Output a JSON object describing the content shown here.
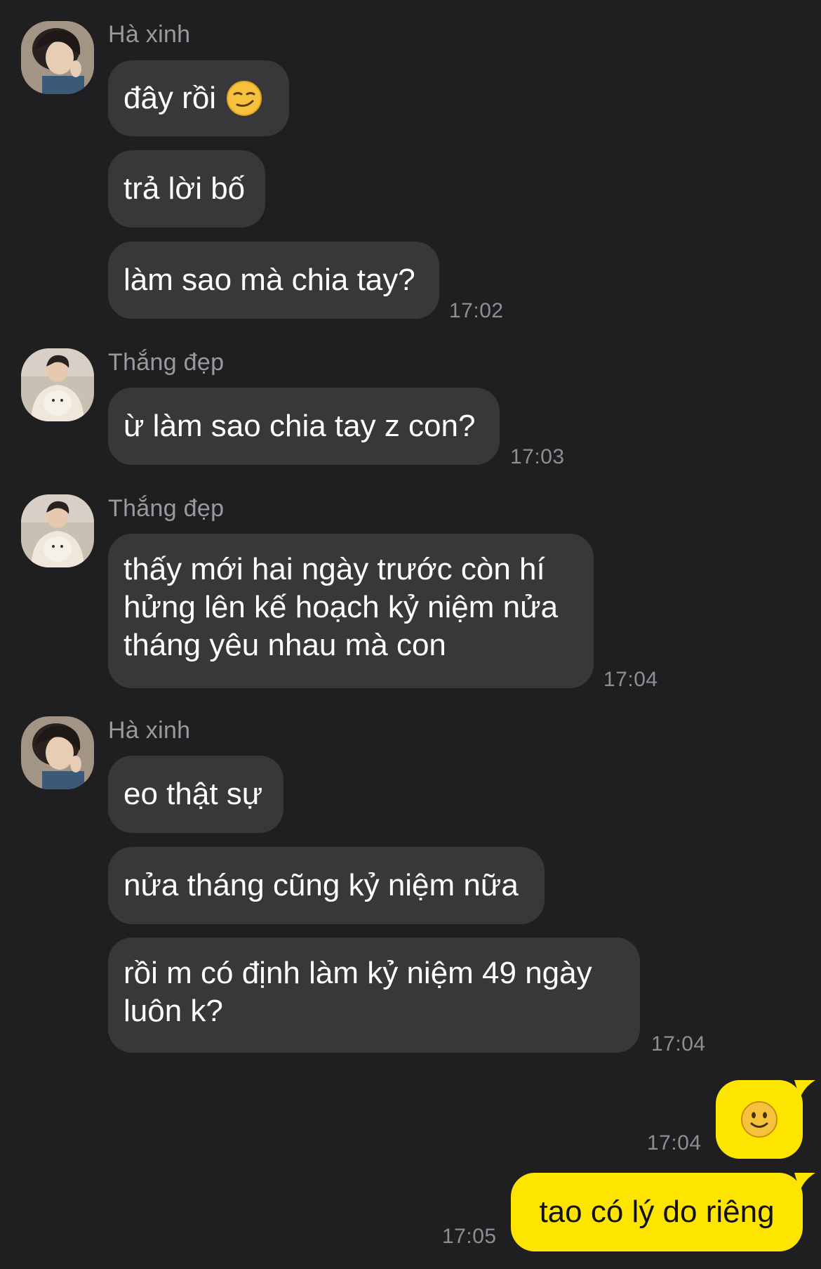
{
  "contacts": {
    "ha": {
      "name": "Hà xinh"
    },
    "thang": {
      "name": "Thắng đẹp"
    }
  },
  "colors": {
    "background": "#1f1f21",
    "incoming_bubble": "#38383a",
    "outgoing_bubble": "#fee500",
    "sender_name": "#9a9a9e",
    "timestamp": "#8e8e93"
  },
  "messages": [
    {
      "group": "g1",
      "sender": "Hà xinh",
      "text": "đây rồi",
      "emoji": "smirking-face-icon"
    },
    {
      "group": "g1",
      "sender": "Hà xinh",
      "text": "trả lời bố"
    },
    {
      "group": "g1",
      "sender": "Hà xinh",
      "text": "làm sao mà chia tay?",
      "time": "17:02"
    },
    {
      "group": "g2",
      "sender": "Thắng đẹp",
      "text": "ừ làm sao chia tay z con?",
      "time": "17:03"
    },
    {
      "group": "g3",
      "sender": "Thắng đẹp",
      "lines": [
        "thấy mới hai ngày trước còn hí",
        "hửng lên kế hoạch kỷ niệm nửa",
        "tháng yêu nhau mà con"
      ],
      "time": "17:04"
    },
    {
      "group": "g4",
      "sender": "Hà xinh",
      "text": "eo thật sự"
    },
    {
      "group": "g4",
      "sender": "Hà xinh",
      "text": "nửa tháng cũng kỷ niệm nữa"
    },
    {
      "group": "g4",
      "sender": "Hà xinh",
      "lines": [
        "rồi m có định làm kỷ niệm 49 ngày",
        "luôn k?"
      ],
      "time": "17:04"
    },
    {
      "group": "me",
      "sender": "me",
      "emoji": "slightly-smiling-face-icon",
      "time": "17:04"
    },
    {
      "group": "me",
      "sender": "me",
      "text": "tao có lý do riêng",
      "time": "17:05"
    }
  ]
}
